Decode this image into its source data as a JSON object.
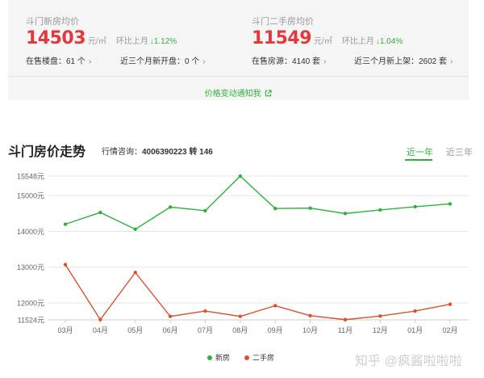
{
  "summary": {
    "new_house": {
      "title": "斗门新房均价",
      "price": "14503",
      "unit": "元/㎡",
      "mom_label": "环比上月",
      "mom_value": "↓1.12%",
      "stat1": "在售楼盘：61 个",
      "stat2": "近三个月新开盘：0 个"
    },
    "second_hand": {
      "title": "斗门二手房均价",
      "price": "11549",
      "unit": "元/㎡",
      "mom_label": "环比上月",
      "mom_value": "↓1.04%",
      "stat1": "在售房源：4140 套",
      "stat2": "近三个月新上架：2602 套"
    },
    "notify_label": "价格变动通知我"
  },
  "trend": {
    "title": "斗门房价走势",
    "hotline_label": "行情咨询：",
    "hotline_number": "4006390223 转 146",
    "tabs": [
      "近一年",
      "近三年"
    ],
    "active_tab": "近一年"
  },
  "watermark": "知乎 @疯酱啦啦啦",
  "colors": {
    "price_red": "#e4393c",
    "down_green": "#2eb33a",
    "new_series": "#2eb33a",
    "second_series": "#d9522c",
    "grid": "#e6e6e6",
    "card_bg": "#f5f5f5"
  },
  "icons": {
    "chevron": "chevron-right-icon",
    "external": "external-link-icon"
  },
  "chart_data": {
    "type": "line",
    "categories": [
      "03月",
      "04月",
      "05月",
      "06月",
      "07月",
      "08月",
      "09月",
      "10月",
      "11月",
      "12月",
      "01月",
      "02月"
    ],
    "y_ticks": [
      {
        "value": 15548,
        "label": "15548元"
      },
      {
        "value": 15000,
        "label": "15000元"
      },
      {
        "value": 14000,
        "label": "14000元"
      },
      {
        "value": 13000,
        "label": "13000元"
      },
      {
        "value": 12000,
        "label": "12000元"
      },
      {
        "value": 11524,
        "label": "11524元"
      }
    ],
    "ylim": [
      11524,
      15548
    ],
    "grid": true,
    "legend_position": "bottom-center",
    "series": [
      {
        "name": "新房",
        "color": "#2eb33a",
        "values": [
          14200,
          14530,
          14060,
          14680,
          14580,
          15548,
          14640,
          14650,
          14500,
          14600,
          14690,
          14770
        ]
      },
      {
        "name": "二手房",
        "color": "#d9522c",
        "values": [
          13070,
          11530,
          12850,
          11620,
          11770,
          11620,
          11920,
          11640,
          11530,
          11630,
          11770,
          11960
        ]
      }
    ]
  }
}
